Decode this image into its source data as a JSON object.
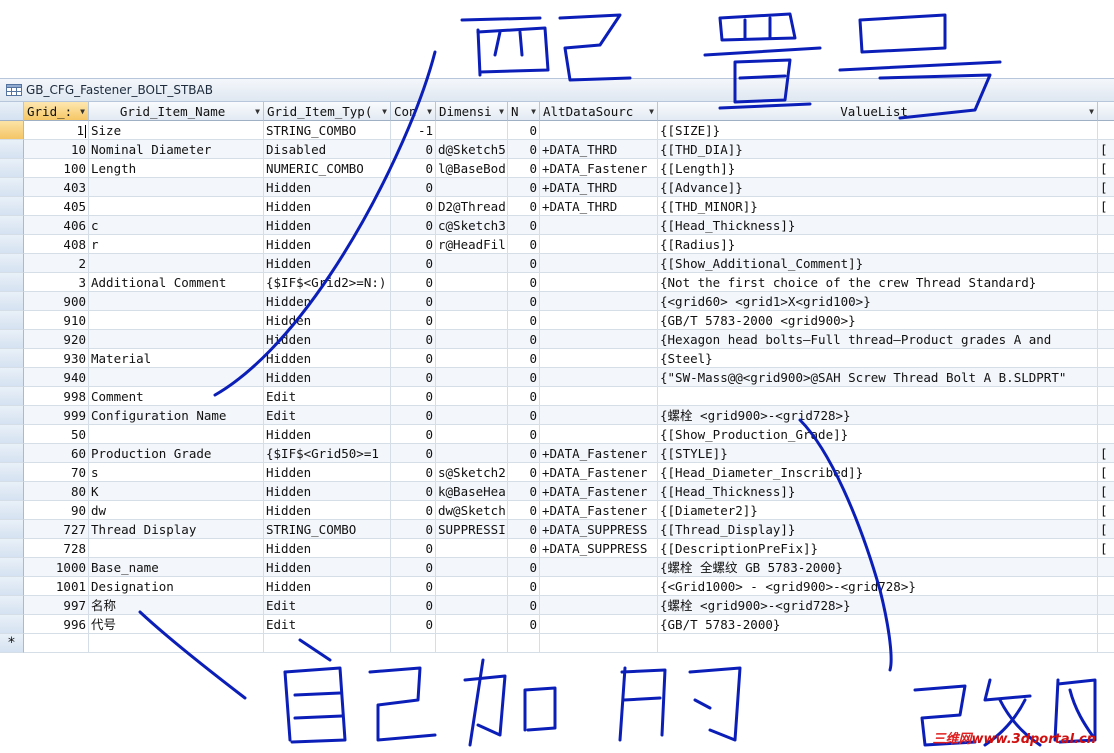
{
  "window": {
    "title": "GB_CFG_Fastener_BOLT_STBAB"
  },
  "columns": [
    {
      "label": "Grid_:"
    },
    {
      "label": "Grid_Item_Name"
    },
    {
      "label": "Grid_Item_Typ("
    },
    {
      "label": "Con"
    },
    {
      "label": "Dimensi"
    },
    {
      "label": "N"
    },
    {
      "label": "AltDataSourc"
    },
    {
      "label": "ValueList"
    }
  ],
  "rows": [
    {
      "id": "1",
      "name": "Size",
      "type": "STRING_COMBO",
      "con": "-1",
      "dim": "",
      "n": "0",
      "alt": "",
      "val": "{[SIZE]}",
      "extra": ""
    },
    {
      "id": "10",
      "name": "Nominal  Diameter",
      "type": "Disabled",
      "con": "0",
      "dim": "d@Sketch5",
      "n": "0",
      "alt": "+DATA_THRD",
      "val": "{[THD_DIA]}",
      "extra": "["
    },
    {
      "id": "100",
      "name": "Length",
      "type": "NUMERIC_COMBO",
      "con": "0",
      "dim": "l@BaseBod",
      "n": "0",
      "alt": "+DATA_Fastener",
      "val": "{[Length]}",
      "extra": "["
    },
    {
      "id": "403",
      "name": "",
      "type": "Hidden",
      "con": "0",
      "dim": "",
      "n": "0",
      "alt": "+DATA_THRD",
      "val": "{[Advance]}",
      "extra": "["
    },
    {
      "id": "405",
      "name": "",
      "type": "Hidden",
      "con": "0",
      "dim": "D2@Thread",
      "n": "0",
      "alt": "+DATA_THRD",
      "val": "{[THD_MINOR]}",
      "extra": "["
    },
    {
      "id": "406",
      "name": "c",
      "type": "Hidden",
      "con": "0",
      "dim": "c@Sketch3",
      "n": "0",
      "alt": "",
      "val": "{[Head_Thickness]}",
      "extra": ""
    },
    {
      "id": "408",
      "name": "r",
      "type": "Hidden",
      "con": "0",
      "dim": "r@HeadFil",
      "n": "0",
      "alt": "",
      "val": "{[Radius]}",
      "extra": ""
    },
    {
      "id": "2",
      "name": "",
      "type": "Hidden",
      "con": "0",
      "dim": "",
      "n": "0",
      "alt": "",
      "val": "{[Show_Additional_Comment]}",
      "extra": ""
    },
    {
      "id": "3",
      "name": "Additional Comment",
      "type": "{$IF$<Grid2>=N:)",
      "con": "0",
      "dim": "",
      "n": "0",
      "alt": "",
      "val": "{Not the first choice of the crew Thread Standard}",
      "extra": ""
    },
    {
      "id": "900",
      "name": "",
      "type": "Hidden",
      "con": "0",
      "dim": "",
      "n": "0",
      "alt": "",
      "val": "{<grid60> <grid1>X<grid100>}",
      "extra": ""
    },
    {
      "id": "910",
      "name": "",
      "type": "Hidden",
      "con": "0",
      "dim": "",
      "n": "0",
      "alt": "",
      "val": "{GB/T 5783-2000 <grid900>}",
      "extra": ""
    },
    {
      "id": "920",
      "name": "",
      "type": "Hidden",
      "con": "0",
      "dim": "",
      "n": "0",
      "alt": "",
      "val": "{Hexagon head bolts—Full thread—Product grades A and",
      "extra": ""
    },
    {
      "id": "930",
      "name": "Material",
      "type": "Hidden",
      "con": "0",
      "dim": "",
      "n": "0",
      "alt": "",
      "val": "{Steel}",
      "extra": ""
    },
    {
      "id": "940",
      "name": "",
      "type": "Hidden",
      "con": "0",
      "dim": "",
      "n": "0",
      "alt": "",
      "val": "{\"SW-Mass@@<grid900>@SAH Screw  Thread Bolt A B.SLDPRT\"",
      "extra": ""
    },
    {
      "id": "998",
      "name": "Comment",
      "type": "Edit",
      "con": "0",
      "dim": "",
      "n": "0",
      "alt": "",
      "val": "",
      "extra": ""
    },
    {
      "id": "999",
      "name": "Configuration Name",
      "type": "Edit",
      "con": "0",
      "dim": "",
      "n": "0",
      "alt": "",
      "val": "{螺栓 <grid900>-<grid728>}",
      "extra": ""
    },
    {
      "id": "50",
      "name": "",
      "type": "Hidden",
      "con": "0",
      "dim": "",
      "n": "0",
      "alt": "",
      "val": "{[Show_Production_Grade]}",
      "extra": ""
    },
    {
      "id": "60",
      "name": "Production Grade",
      "type": "{$IF$<Grid50>=1",
      "con": "0",
      "dim": "",
      "n": "0",
      "alt": "+DATA_Fastener",
      "val": "{[STYLE]}",
      "extra": "["
    },
    {
      "id": "70",
      "name": "s",
      "type": "Hidden",
      "con": "0",
      "dim": "s@Sketch2",
      "n": "0",
      "alt": "+DATA_Fastener",
      "val": "{[Head_Diameter_Inscribed]}",
      "extra": "["
    },
    {
      "id": "80",
      "name": "K",
      "type": "Hidden",
      "con": "0",
      "dim": "k@BaseHea",
      "n": "0",
      "alt": "+DATA_Fastener",
      "val": "{[Head_Thickness]}",
      "extra": "["
    },
    {
      "id": "90",
      "name": "dw",
      "type": "Hidden",
      "con": "0",
      "dim": "dw@Sketch",
      "n": "0",
      "alt": "+DATA_Fastener",
      "val": "{[Diameter2]}",
      "extra": "["
    },
    {
      "id": "727",
      "name": "Thread Display",
      "type": "STRING_COMBO",
      "con": "0",
      "dim": "SUPPRESSI",
      "n": "0",
      "alt": "+DATA_SUPPRESS",
      "val": "{[Thread_Display]}",
      "extra": "["
    },
    {
      "id": "728",
      "name": "",
      "type": "Hidden",
      "con": "0",
      "dim": "",
      "n": "0",
      "alt": "+DATA_SUPPRESS",
      "val": "{[DescriptionPreFix]}",
      "extra": "["
    },
    {
      "id": "1000",
      "name": "Base_name",
      "type": "Hidden",
      "con": "0",
      "dim": "",
      "n": "0",
      "alt": "",
      "val": "{螺栓 全螺纹 GB 5783-2000}",
      "extra": ""
    },
    {
      "id": "1001",
      "name": "Designation",
      "type": "Hidden",
      "con": "0",
      "dim": "",
      "n": "0",
      "alt": "",
      "val": "{<Grid1000> - <grid900>-<grid728>}",
      "extra": ""
    },
    {
      "id": "997",
      "name": "名称",
      "type": "Edit",
      "con": "0",
      "dim": "",
      "n": "0",
      "alt": "",
      "val": "{螺栓 <grid900>-<grid728>}",
      "extra": ""
    },
    {
      "id": "996",
      "name": "代号",
      "type": "Edit",
      "con": "0",
      "dim": "",
      "n": "0",
      "alt": "",
      "val": "{GB/T 5783-2000}",
      "extra": ""
    }
  ],
  "new_row_marker": "*",
  "watermark": {
    "part1": "三维网",
    "part2": "www.3dportal.cn"
  },
  "colors": {
    "header_active": "#f6c766",
    "ink": "#0b1fb8",
    "grid_line": "#d5dde6"
  }
}
